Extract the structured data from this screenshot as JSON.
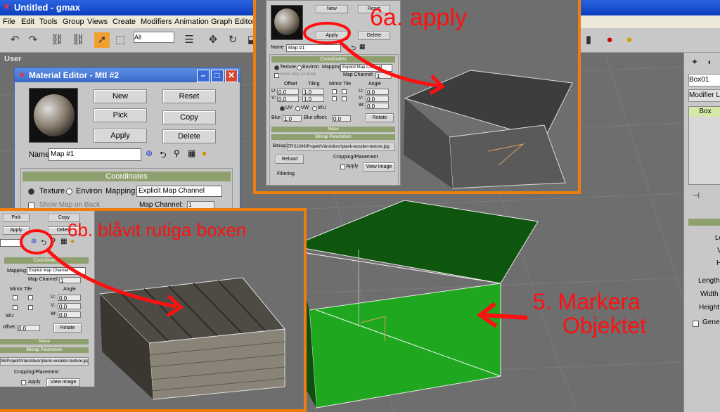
{
  "window": {
    "title": "Untitled - gmax"
  },
  "menu": [
    "File",
    "Edit",
    "Tools",
    "Group",
    "Views",
    "Create",
    "Modifiers",
    "Animation",
    "Graph Editors"
  ],
  "toolbar": {
    "selection_filter": "All"
  },
  "viewport": {
    "label": "User"
  },
  "material_editor": {
    "title": "Material Editor - Mtl #2",
    "buttons": {
      "new": "New",
      "reset": "Reset",
      "pick": "Pick",
      "copy": "Copy",
      "apply": "Apply",
      "delete": "Delete"
    },
    "name_label": "Name",
    "name_value": "Map #1",
    "coords_title": "Coordinates",
    "texture_label": "Texture",
    "environ_label": "Environ",
    "mapping_label": "Mapping:",
    "mapping_value": "Explicit Map Channel",
    "show_map_label": "Show Map on Back",
    "map_channel_label": "Map Channel:",
    "map_channel_value": "1"
  },
  "inset_a": {
    "buttons": {
      "new": "New",
      "reset": "Reset",
      "apply": "Apply",
      "delete": "Delete"
    },
    "name_label": "Name",
    "name_value": "Map #1",
    "coords_title": "Coordinates",
    "texture_label": "Texture",
    "environ_label": "Environ",
    "mapping_label": "Mapping:",
    "mapping_value": "Explicit Map Channel",
    "show_map_label": "Show Map on Back",
    "map_channel_label": "Map Channel:",
    "map_channel_value": "1",
    "offset_label": "Offset",
    "tiling_label": "Tiling",
    "mirror_tile_label": "Mirror Tile",
    "angle_label": "Angle",
    "u_label": "U:",
    "v_label": "V:",
    "w_label": "W:",
    "offset_u": "0.0",
    "offset_v": "0.0",
    "tiling_u": "1.0",
    "tiling_v": "1.0",
    "angle_u": "0.0",
    "angle_v": "0.0",
    "angle_w": "0.0",
    "uv_label": "UV",
    "vw_label": "VW",
    "wu_label": "WU",
    "blur_label": "Blur:",
    "blur_value": "1.0",
    "blur_offset_label": "Blur offset:",
    "blur_offset_value": "0.0",
    "rotate": "Rotate",
    "noise_title": "Noise",
    "bitmap_params_title": "Bitmap Parameters",
    "bitmap_label": "Bitmap:",
    "bitmap_path": "ERS2006\\Projekt\\Vändslivor\\plank-wooden-texture.jpg",
    "reload": "Reload",
    "cropping_label": "Cropping/Placement",
    "apply_chk": "Apply",
    "view_image": "View Image",
    "filtering_label": "Filtering",
    "annotation": "6a. apply"
  },
  "inset_b": {
    "buttons": {
      "pick": "Pick",
      "copy": "Copy",
      "apply": "Apply",
      "delete": "Delete"
    },
    "coords_title": "Coordinates",
    "mapping_label": "Mapping:",
    "mapping_value": "Explicit Map Channel",
    "map_channel_label": "Map Channel:",
    "map_channel_value": "1",
    "mirror_tile_label": "Mirror Tile",
    "angle_label": "Angle",
    "u_label": "U:",
    "v_label": "V:",
    "w_label": "W:",
    "angle_u": "0.0",
    "angle_v": "0.0",
    "angle_w": "0.0",
    "wu_label": "WU",
    "offset_label": "offset:",
    "offset_value": "0.0",
    "rotate": "Rotate",
    "noise_title": "Noise",
    "bitmap_params_title": "Bitmap Parameters",
    "bitmap_path": "06\\Projekt\\Vändslivor\\plank-wooden-texture.jpg",
    "cropping_label": "Cropping/Placement",
    "apply_chk": "Apply",
    "view_image": "View Image",
    "annotation": "6b. blåvit rutiga boxen"
  },
  "annotation_5": [
    "5. Markera",
    "Objektet"
  ],
  "command_panel": {
    "object_name": "Box01",
    "modifier_list": "Modifier Li",
    "stack_item": "Box",
    "params": [
      "Le",
      "V",
      "H",
      "Length",
      "Width",
      "Height",
      "Gene"
    ]
  },
  "colors": {
    "highlight": "#f07d10",
    "annotation": "#ff1010",
    "selected_box": "#1fa81f",
    "title_bar": "#0a3fbf"
  }
}
